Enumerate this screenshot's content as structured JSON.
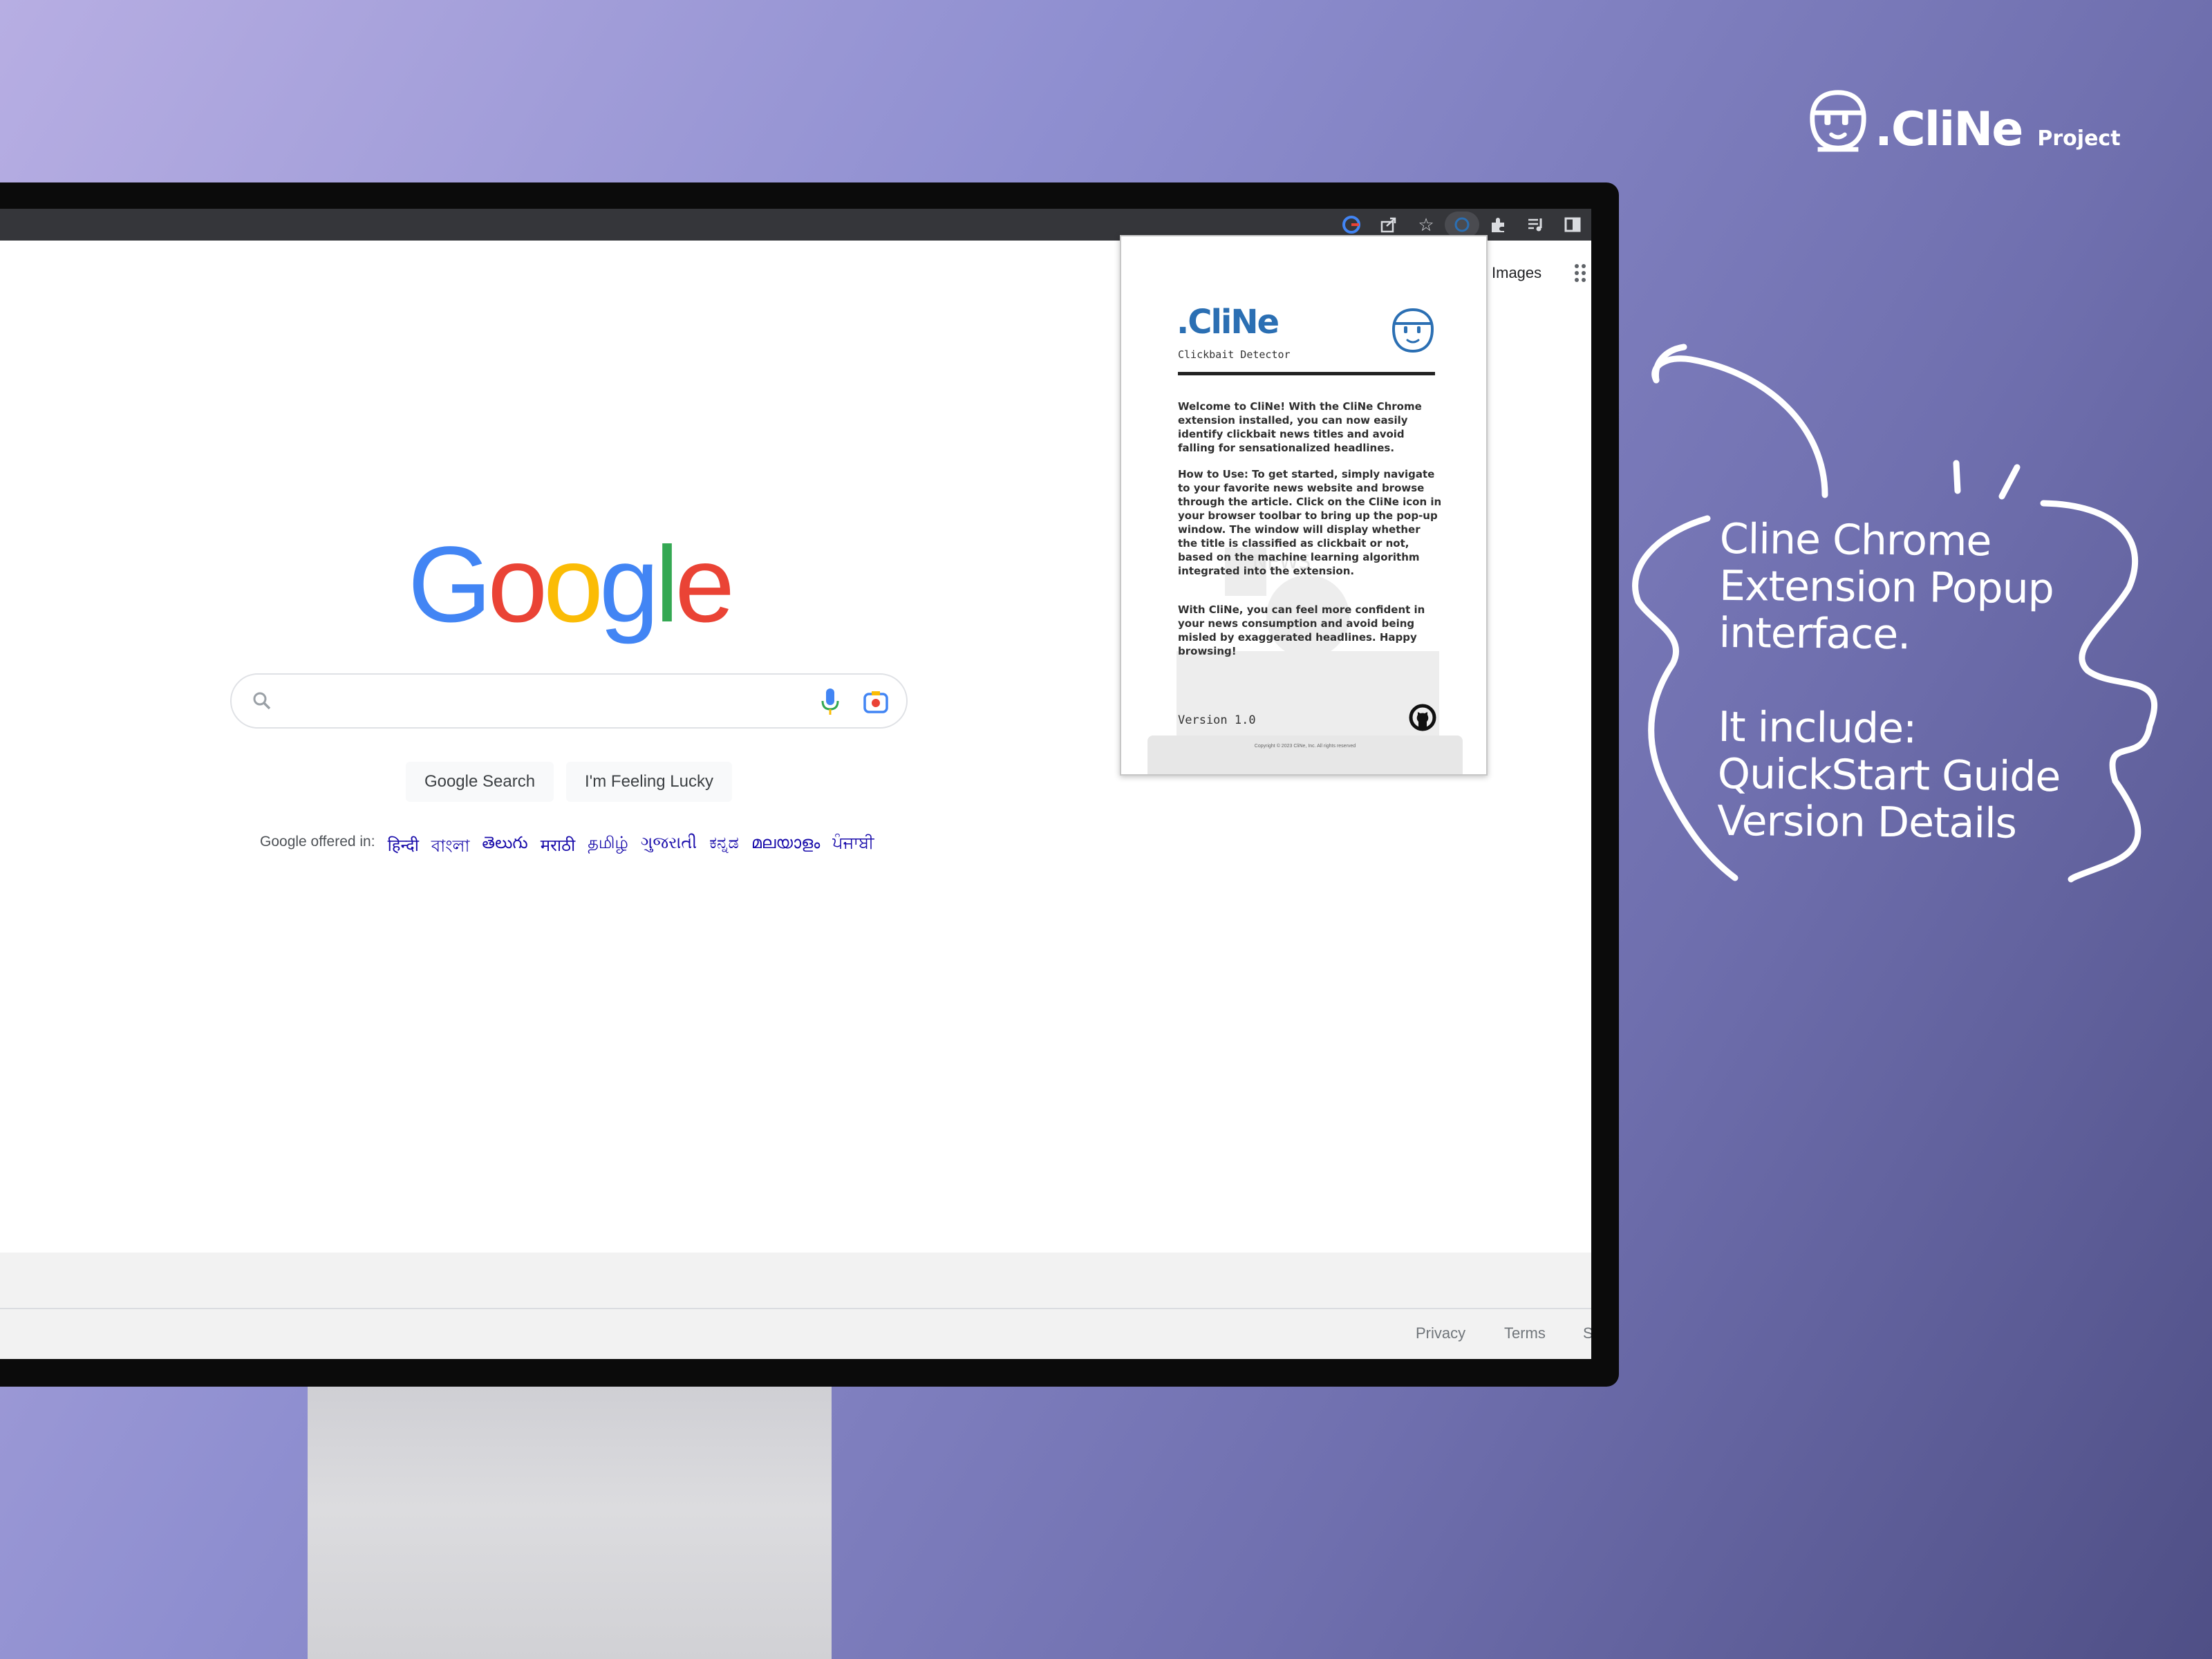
{
  "brand": {
    "name": ".CliNe",
    "sub": "Project"
  },
  "browser": {
    "toolbar_icons": [
      "google-icon",
      "share-icon",
      "bookmark-star-icon",
      "cline-extension-icon",
      "puzzle-extensions-icon",
      "media-control-icon",
      "side-panel-icon"
    ]
  },
  "google": {
    "images_link": "Images",
    "logo_letters": [
      {
        "ch": "G",
        "color": "#4285F4"
      },
      {
        "ch": "o",
        "color": "#EA4335"
      },
      {
        "ch": "o",
        "color": "#FBBC05"
      },
      {
        "ch": "g",
        "color": "#4285F4"
      },
      {
        "ch": "l",
        "color": "#34A853"
      },
      {
        "ch": "e",
        "color": "#EA4335"
      }
    ],
    "search_placeholder": "",
    "search_button": "Google Search",
    "lucky_button": "I'm Feeling Lucky",
    "offered_in": "Google offered in:",
    "languages": [
      "हिन्दी",
      "বাংলা",
      "తెలుగు",
      "मराठी",
      "தமிழ்",
      "ગુજરાતી",
      "ಕನ್ನಡ",
      "മലയാളം",
      "ਪੰਜਾਬੀ"
    ],
    "footer": {
      "privacy": "Privacy",
      "terms": "Terms",
      "settings_partial": "S"
    }
  },
  "popup": {
    "title": ".CliNe",
    "subtitle": "Clickbait Detector",
    "welcome": "Welcome to CliNe! With the CliNe Chrome extension installed, you can now easily identify clickbait news titles and avoid falling for sensationalized headlines.",
    "how_to": "How to Use: To get started, simply navigate to your favorite news website and browse through the article. Click on the CliNe icon in your browser toolbar to bring up the pop-up window. The window will display whether the title is classified as clickbait or not, based on the machine learning algorithm integrated into the extension.",
    "closing": "With CliNe, you can feel more confident in your news consumption and avoid being misled by exaggerated headlines. Happy browsing!",
    "watermark": "NEWS",
    "version": "Version 1.0",
    "copyright": "Copyright © 2023 CliNe, Inc. All rights reserved"
  },
  "annotation": {
    "lines": [
      "Cline Chrome",
      "Extension Popup",
      "interface.",
      "",
      "It include:",
      "QuickStart Guide",
      "Version Details"
    ]
  }
}
